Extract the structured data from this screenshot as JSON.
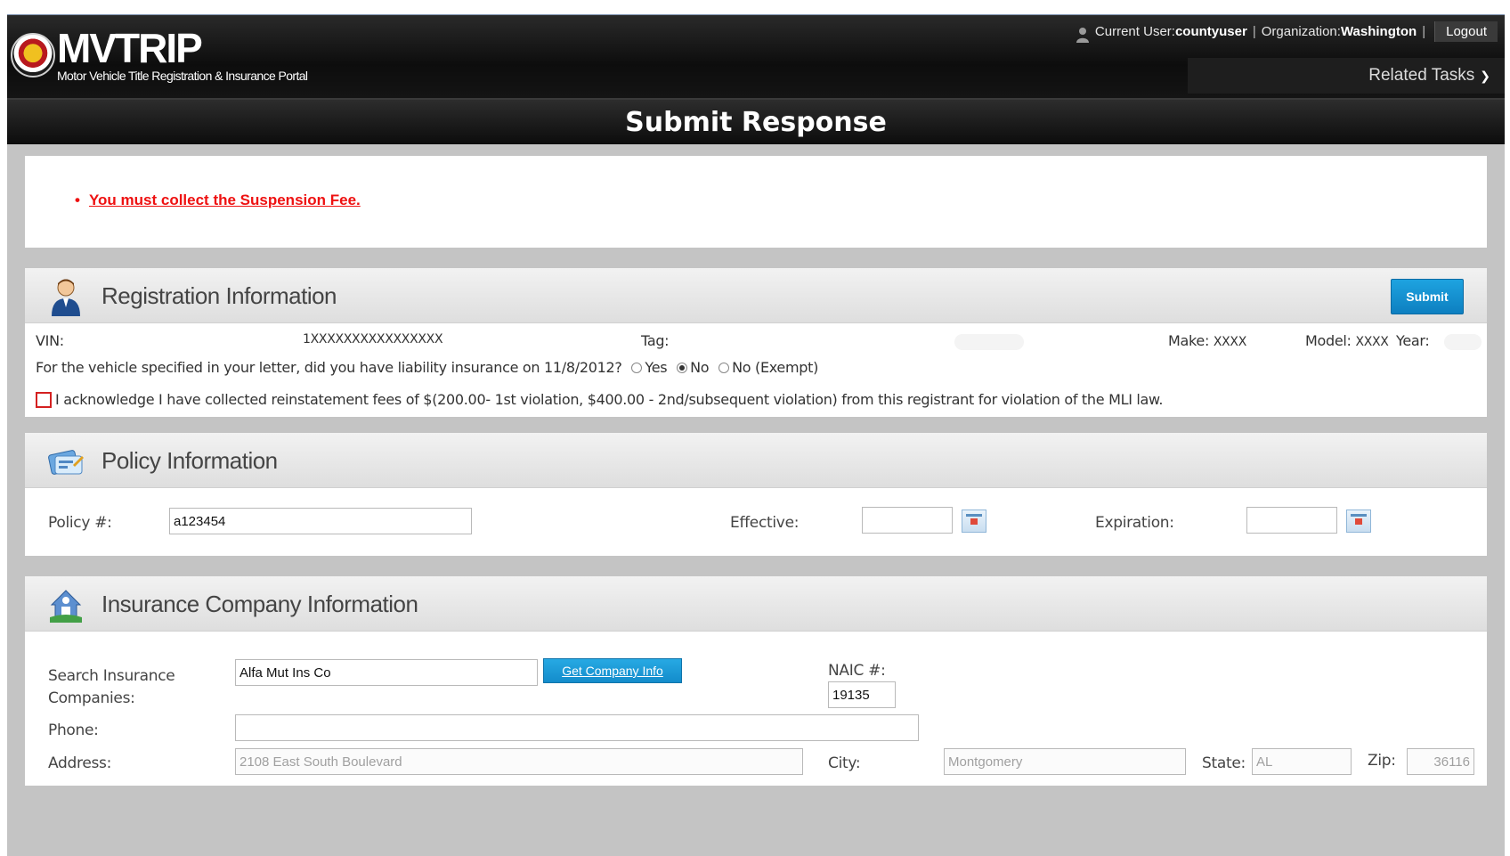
{
  "app": {
    "logo_title": "MVTRIP",
    "logo_subtitle": "Motor Vehicle Title Registration & Insurance Portal"
  },
  "user_bar": {
    "user_prefix": "Current User: ",
    "user": "countyuser",
    "org_prefix": "Organization: ",
    "organization": "Washington",
    "logout_label": "Logout"
  },
  "menu": {
    "related_tasks_label": "Related Tasks"
  },
  "page": {
    "title": "Submit Response"
  },
  "errors": {
    "items": [
      "You must collect the Suspension Fee."
    ],
    "color": "#ee1111"
  },
  "registration": {
    "section_title": "Registration Information",
    "submit_label": "Submit",
    "vin_label": "VIN:",
    "vin_value": "1XXXXXXXXXXXXXXXX",
    "tag_label": "Tag:",
    "make_label": "Make:",
    "make_value": "XXXX",
    "model_label": "Model:",
    "model_value": "XXXX",
    "year_label": "Year:",
    "question": "For the vehicle specified in your letter, did you have liability insurance on 11/8/2012?",
    "radio_yes": "Yes",
    "radio_no": "No",
    "radio_exempt": "No (Exempt)",
    "selected": "No",
    "ack_text": "I acknowledge I have collected reinstatement fees of $(200.00- 1st violation, $400.00 - 2nd/subsequent violation) from this registrant for violation of the MLI law."
  },
  "policy": {
    "section_title": "Policy Information",
    "policy_label": "Policy #:",
    "policy_value": "a123454",
    "effective_label": "Effective:",
    "effective_value": "",
    "expiration_label": "Expiration:",
    "expiration_value": ""
  },
  "insurance": {
    "section_title": "Insurance Company Information",
    "search_label_1": "Search Insurance",
    "search_label_2": "Companies:",
    "search_value": "Alfa Mut Ins Co",
    "get_company_label": "Get Company Info",
    "naic_label": "NAIC #:",
    "naic_value": "19135",
    "phone_label": "Phone:",
    "phone_value": "",
    "address_label": "Address:",
    "address_value": "2108 East South Boulevard",
    "city_label": "City:",
    "city_value": "Montgomery",
    "state_label": "State:",
    "state_value": "AL",
    "zip_label": "Zip:",
    "zip_value": "36116"
  },
  "colors": {
    "header_bg": "#111111",
    "accent_button": "#1a95d6",
    "error_text": "#ee1111",
    "app_bg": "#c4c4c4"
  },
  "icons": [
    "logo-seal-icon",
    "user-icon",
    "chevron-down-icon",
    "person-icon",
    "policy-card-icon",
    "insurance-house-icon",
    "calendar-icon"
  ]
}
